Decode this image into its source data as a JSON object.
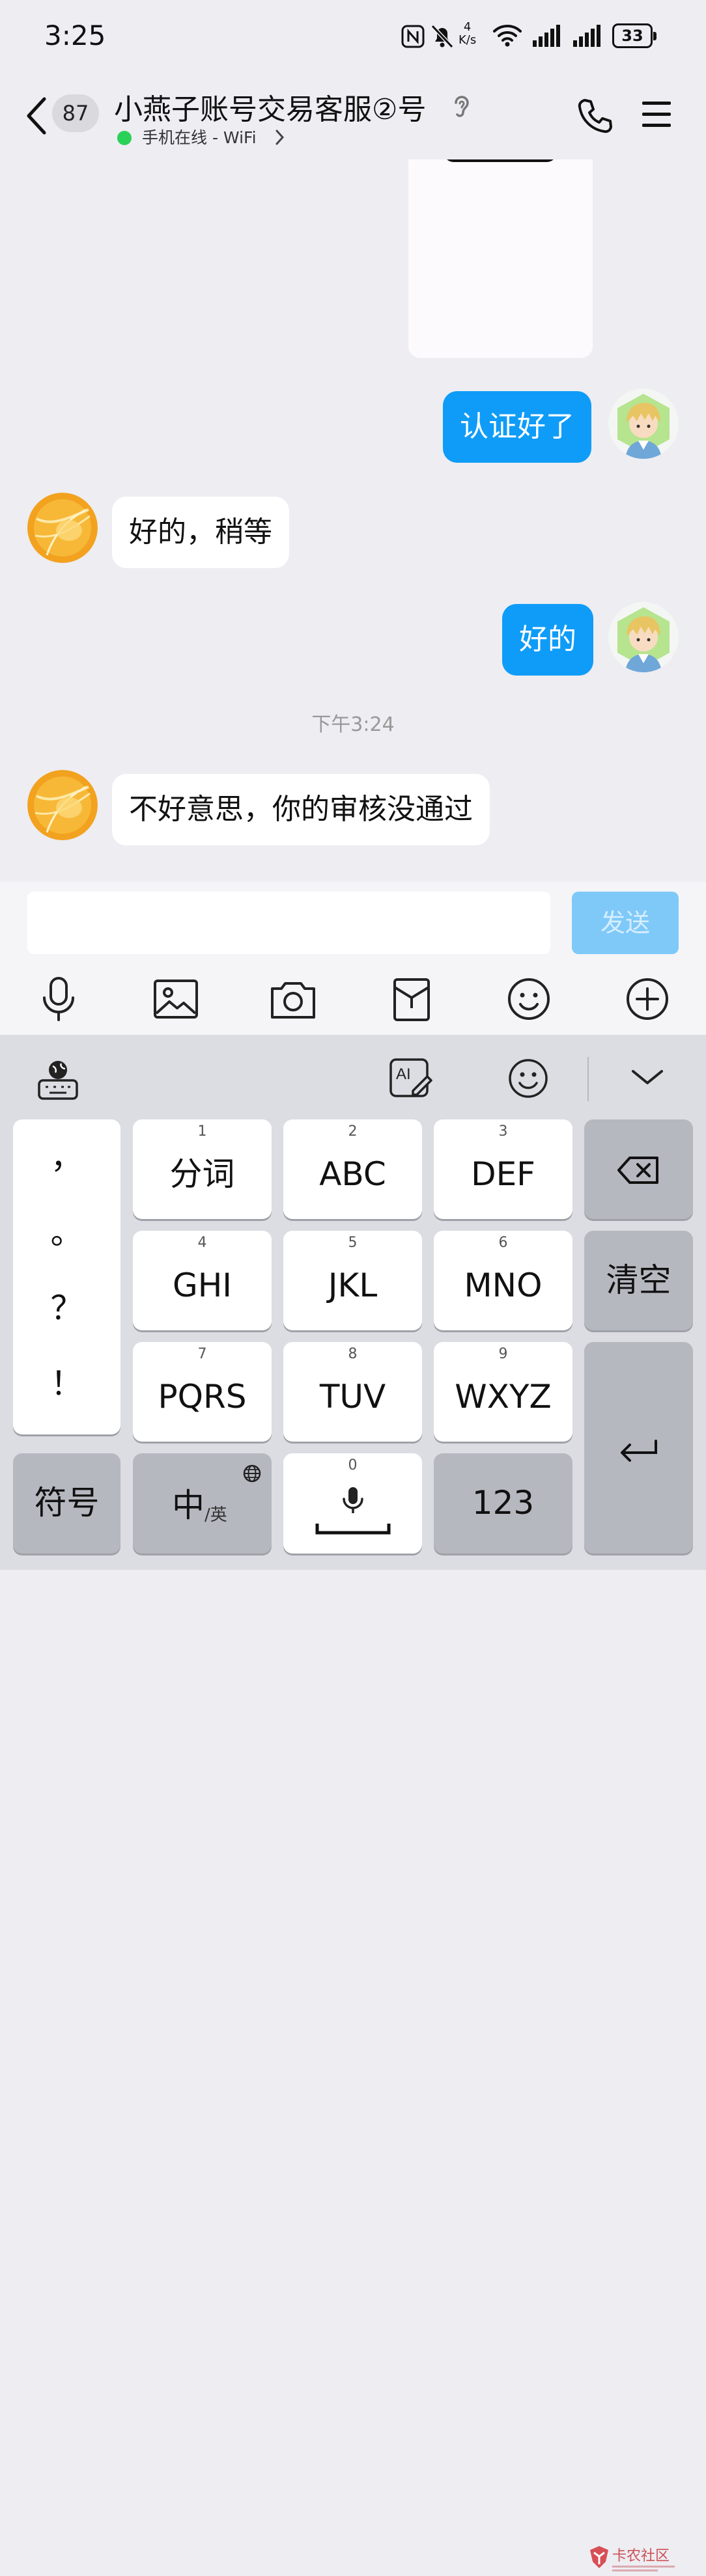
{
  "status_bar": {
    "time": "3:25",
    "net_speed_value": "4",
    "net_speed_unit": "K/s",
    "battery": "33"
  },
  "header": {
    "unread_count": "87",
    "title": "小燕子账号交易客服②号",
    "status": "手机在线 - WiFi",
    "status_color": "#2ad158"
  },
  "messages": [
    {
      "sender": "me",
      "text": "认证好了"
    },
    {
      "sender": "them",
      "text": "好的，稍等"
    },
    {
      "sender": "me",
      "text": "好的"
    },
    {
      "timestamp": "下午3:24"
    },
    {
      "sender": "them",
      "text": "不好意思，你的审核没通过"
    }
  ],
  "input": {
    "value": "",
    "send_label": "发送"
  },
  "toolbar": [
    "microphone-icon",
    "image-icon",
    "camera-icon",
    "red-packet-icon",
    "emoji-icon",
    "plus-icon"
  ],
  "keyboard": {
    "top_icons": [
      "globe-keyboard-icon",
      "ai-write-icon",
      "emoji-icon",
      "collapse-icon"
    ],
    "punctuation": [
      "，",
      "。",
      "？",
      "！"
    ],
    "keys": [
      {
        "num": "1",
        "label": "分词"
      },
      {
        "num": "2",
        "label": "ABC"
      },
      {
        "num": "3",
        "label": "DEF"
      },
      {
        "num": "4",
        "label": "GHI"
      },
      {
        "num": "5",
        "label": "JKL"
      },
      {
        "num": "6",
        "label": "MNO"
      },
      {
        "num": "7",
        "label": "PQRS"
      },
      {
        "num": "8",
        "label": "TUV"
      },
      {
        "num": "9",
        "label": "WXYZ"
      }
    ],
    "clear_label": "清空",
    "symbol_label": "符号",
    "lang_main": "中",
    "lang_sub": "/英",
    "space_num": "0",
    "num_label": "123"
  },
  "watermark": {
    "text": "卡农社区"
  },
  "colors": {
    "accent": "#0f9cf8",
    "send_disabled": "#7fc9f9",
    "background": "#ededf2"
  }
}
